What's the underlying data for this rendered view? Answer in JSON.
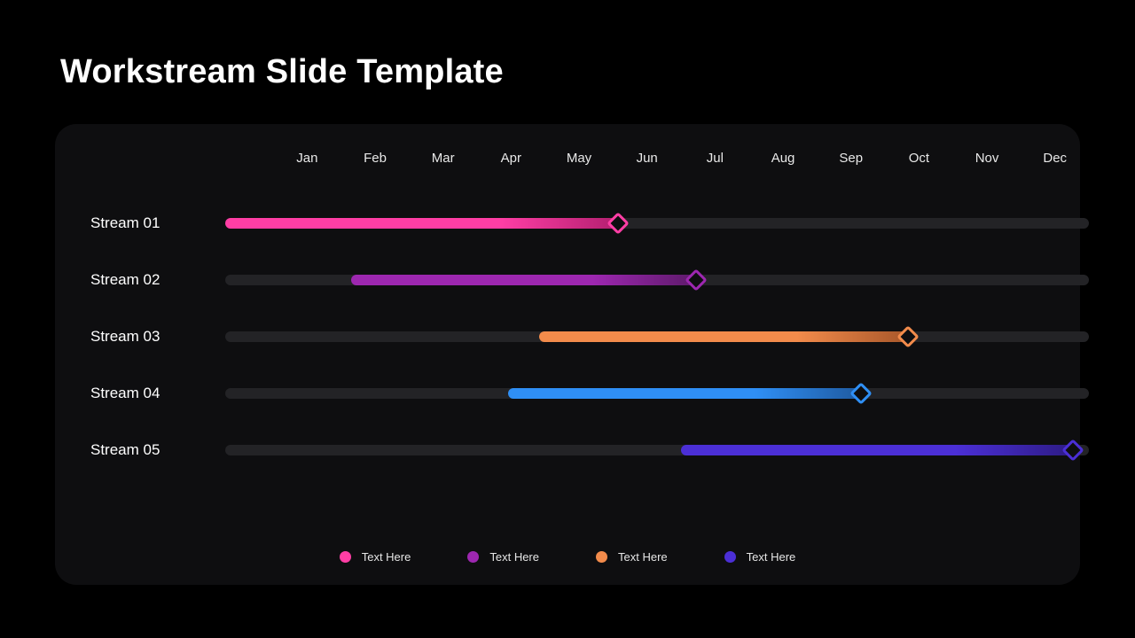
{
  "title": "Workstream Slide Template",
  "chart_data": {
    "type": "bar",
    "orientation": "horizontal-gantt",
    "categories": [
      "Jan",
      "Feb",
      "Mar",
      "Apr",
      "May",
      "Jun",
      "Jul",
      "Aug",
      "Sep",
      "Oct",
      "Nov",
      "Dec"
    ],
    "xlim": [
      1,
      12
    ],
    "series": [
      {
        "name": "Stream 01",
        "start": 1.0,
        "end": 6.0,
        "marker": 6.0,
        "color": "#ff3ea5",
        "dark": "#b31f70"
      },
      {
        "name": "Stream 02",
        "start": 2.6,
        "end": 7.0,
        "marker": 7.0,
        "color": "#9d27b0",
        "dark": "#5d1a6a"
      },
      {
        "name": "Stream 03",
        "start": 5.0,
        "end": 9.7,
        "marker": 9.7,
        "color": "#f28b4b",
        "dark": "#a8572a"
      },
      {
        "name": "Stream 04",
        "start": 4.6,
        "end": 9.1,
        "marker": 9.1,
        "color": "#2f8ff5",
        "dark": "#1f5aa0"
      },
      {
        "name": "Stream 05",
        "start": 6.8,
        "end": 11.8,
        "marker": 11.8,
        "color": "#4b2fd6",
        "dark": "#2d1b85"
      }
    ],
    "legend": [
      {
        "label": "Text Here",
        "color": "#ff3ea5"
      },
      {
        "label": "Text Here",
        "color": "#9d27b0"
      },
      {
        "label": "Text Here",
        "color": "#f28b4b"
      },
      {
        "label": "Text Here",
        "color": "#4b2fd6"
      }
    ]
  }
}
